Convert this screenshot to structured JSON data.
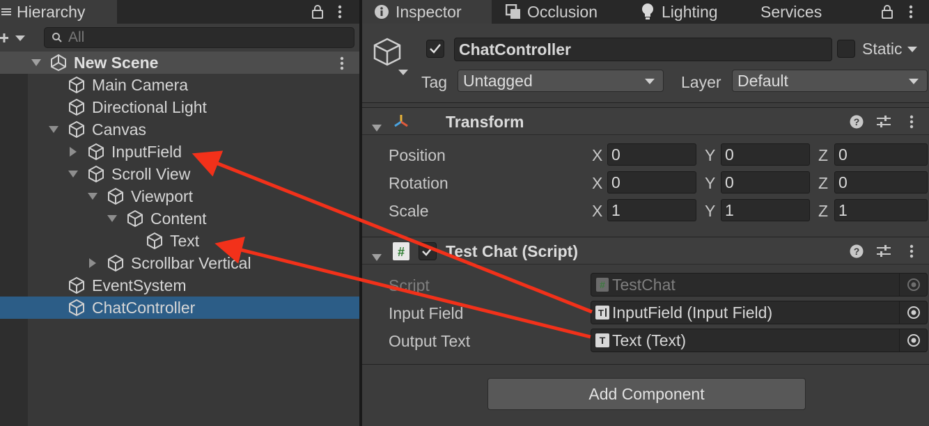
{
  "hierarchy": {
    "tab_label": "Hierarchy",
    "search_placeholder": "All",
    "scene_name": "New Scene",
    "items": [
      {
        "label": "Main Camera"
      },
      {
        "label": "Directional Light"
      },
      {
        "label": "Canvas"
      },
      {
        "label": "InputField"
      },
      {
        "label": "Scroll View"
      },
      {
        "label": "Viewport"
      },
      {
        "label": "Content"
      },
      {
        "label": "Text"
      },
      {
        "label": "Scrollbar Vertical"
      },
      {
        "label": "EventSystem"
      },
      {
        "label": "ChatController"
      }
    ],
    "selected_item": "ChatController"
  },
  "inspector": {
    "tabs": [
      {
        "label": "Inspector",
        "icon": "info-icon"
      },
      {
        "label": "Occlusion",
        "icon": "occlusion-icon"
      },
      {
        "label": "Lighting",
        "icon": "lightbulb-icon"
      },
      {
        "label": "Services",
        "icon": ""
      }
    ],
    "object": {
      "name": "ChatController",
      "active": true,
      "static_label": "Static",
      "static": false,
      "tag_label": "Tag",
      "tag_value": "Untagged",
      "layer_label": "Layer",
      "layer_value": "Default"
    },
    "transform": {
      "title": "Transform",
      "rows": [
        {
          "label": "Position",
          "x": "0",
          "y": "0",
          "z": "0"
        },
        {
          "label": "Rotation",
          "x": "0",
          "y": "0",
          "z": "0"
        },
        {
          "label": "Scale",
          "x": "1",
          "y": "1",
          "z": "1"
        }
      ],
      "axis_x": "X",
      "axis_y": "Y",
      "axis_z": "Z"
    },
    "test_chat": {
      "title": "Test Chat (Script)",
      "enabled": true,
      "script_label": "Script",
      "script_value": "TestChat",
      "input_label": "Input Field",
      "input_value": "InputField (Input Field)",
      "output_label": "Output Text",
      "output_value": "Text (Text)"
    },
    "add_component_label": "Add Component"
  },
  "colors": {
    "selection": "#2c5d87",
    "arrow": "#f2311a",
    "panel": "#3c3c3c",
    "field": "#2a2a2a"
  }
}
